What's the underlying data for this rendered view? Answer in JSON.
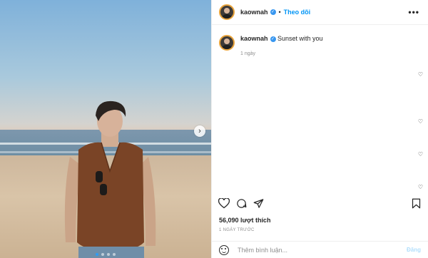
{
  "post": {
    "username": "kaownah",
    "follow_label": "Theo dõi",
    "separator": "•",
    "more_label": "•••",
    "caption_text": "Sunset with you",
    "caption_time": "1 ngày",
    "likes": "56,090 lượt thích",
    "time_ago": "1 NGÀY TRƯỚC",
    "comment_placeholder": "Thêm bình luận...",
    "post_label": "Đăng",
    "carousel_dots": 4,
    "carousel_active_index": 0
  },
  "icons": {
    "verified": "verified-badge-icon",
    "like": "heart-icon",
    "comment": "comment-icon",
    "share": "paper-plane-icon",
    "save": "bookmark-icon",
    "emoji": "smiley-icon",
    "next": "chevron-right-icon"
  },
  "colors": {
    "link": "#0095f6",
    "verified": "#3897f0",
    "post_disabled": "#b2dffc",
    "muted": "#8e8e8e"
  }
}
